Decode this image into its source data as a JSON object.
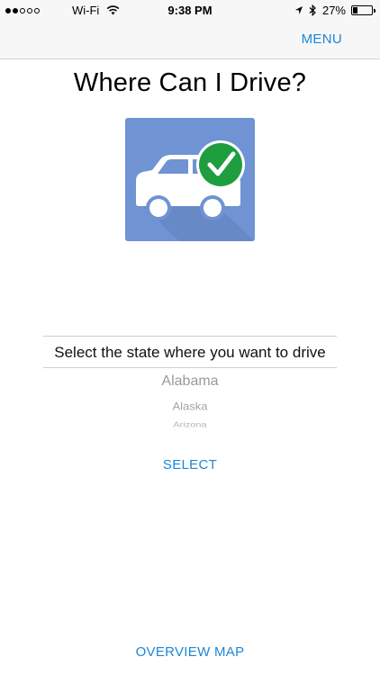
{
  "status_bar": {
    "carrier": "Wi-Fi",
    "time": "9:38 PM",
    "battery_text": "27%",
    "battery_level": 0.27,
    "signal_bars_filled": 2,
    "signal_bars_total": 5
  },
  "nav": {
    "menu_label": "MENU"
  },
  "page": {
    "title": "Where Can I Drive?"
  },
  "picker": {
    "label": "Select the state where you want to drive",
    "options": [
      "Alabama",
      "Alaska",
      "Arizona"
    ]
  },
  "actions": {
    "select_label": "SELECT",
    "overview_label": "OVERVIEW MAP"
  },
  "colors": {
    "accent": "#1b87d8",
    "icon_bg": "#6f93d3",
    "check_green": "#1e9e3e"
  },
  "icons": [
    "location-arrow-icon",
    "bluetooth-icon",
    "wifi-icon",
    "car-icon",
    "checkmark-icon"
  ]
}
